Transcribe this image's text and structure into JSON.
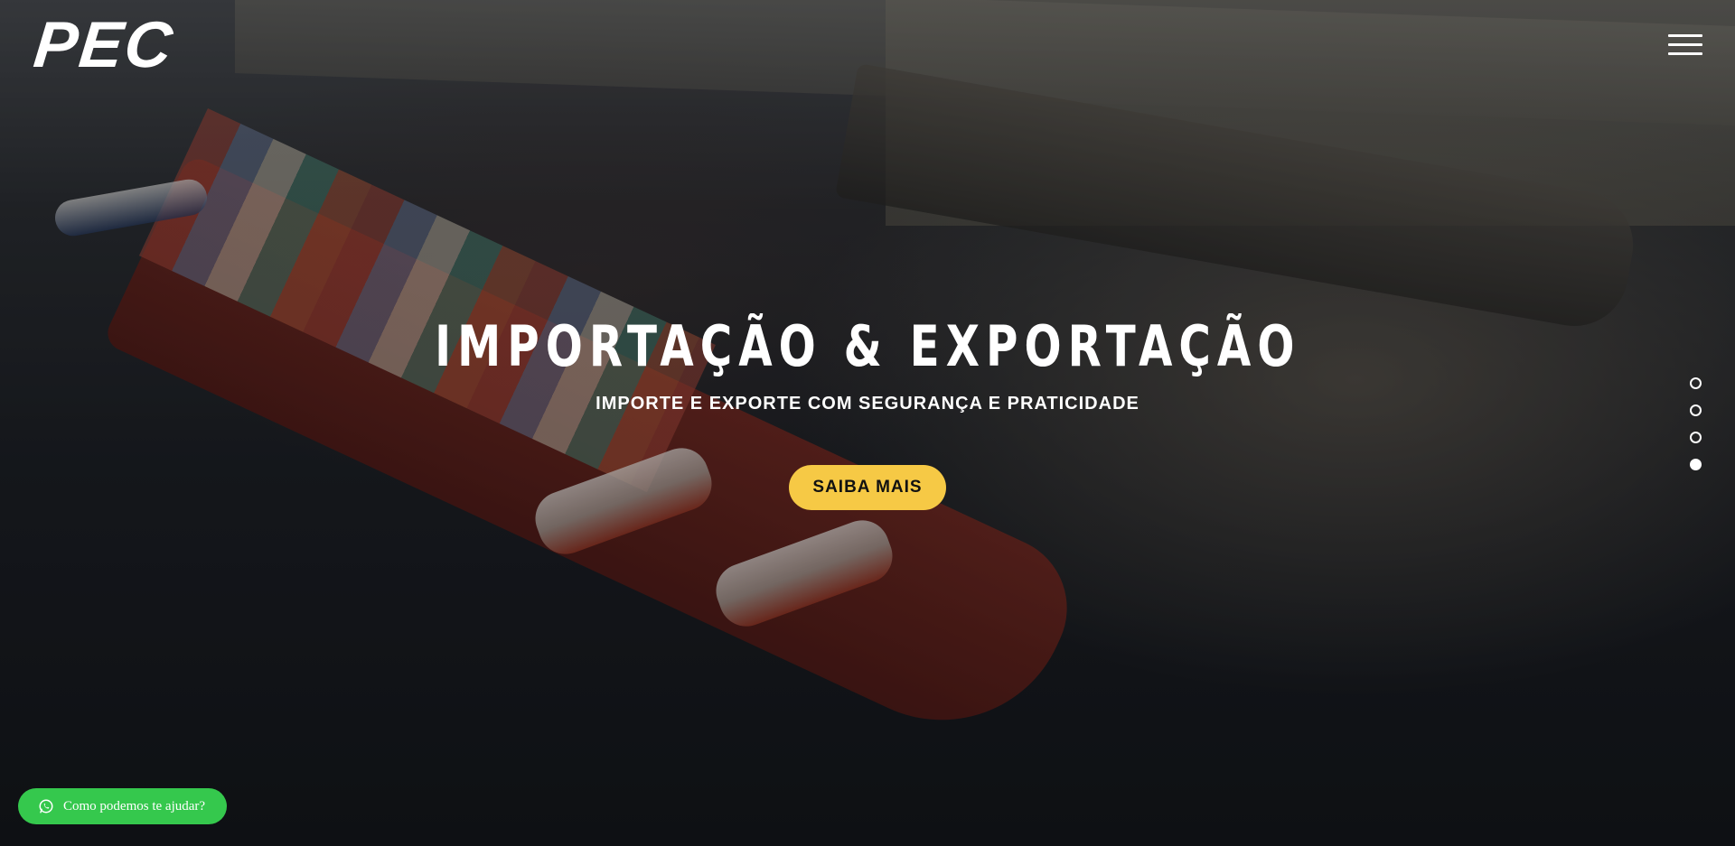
{
  "brand": {
    "logo_text": "PEC"
  },
  "header": {
    "menu_icon": "hamburger-menu-icon"
  },
  "hero": {
    "title": "IMPORTAÇÃO & EXPORTAÇÃO",
    "subtitle": "IMPORTE E EXPORTE COM SEGURANÇA E PRATICIDADE",
    "cta_label": "SAIBA MAIS",
    "background": "container-ship-harbor-photo"
  },
  "slider": {
    "total_slides": 4,
    "active_slide": 4
  },
  "whatsapp": {
    "label": "Como podemos te ajudar?",
    "icon": "whatsapp-icon"
  },
  "colors": {
    "cta_background": "#f6c945",
    "whatsapp_background": "#35c84d",
    "text_primary": "#ffffff"
  }
}
